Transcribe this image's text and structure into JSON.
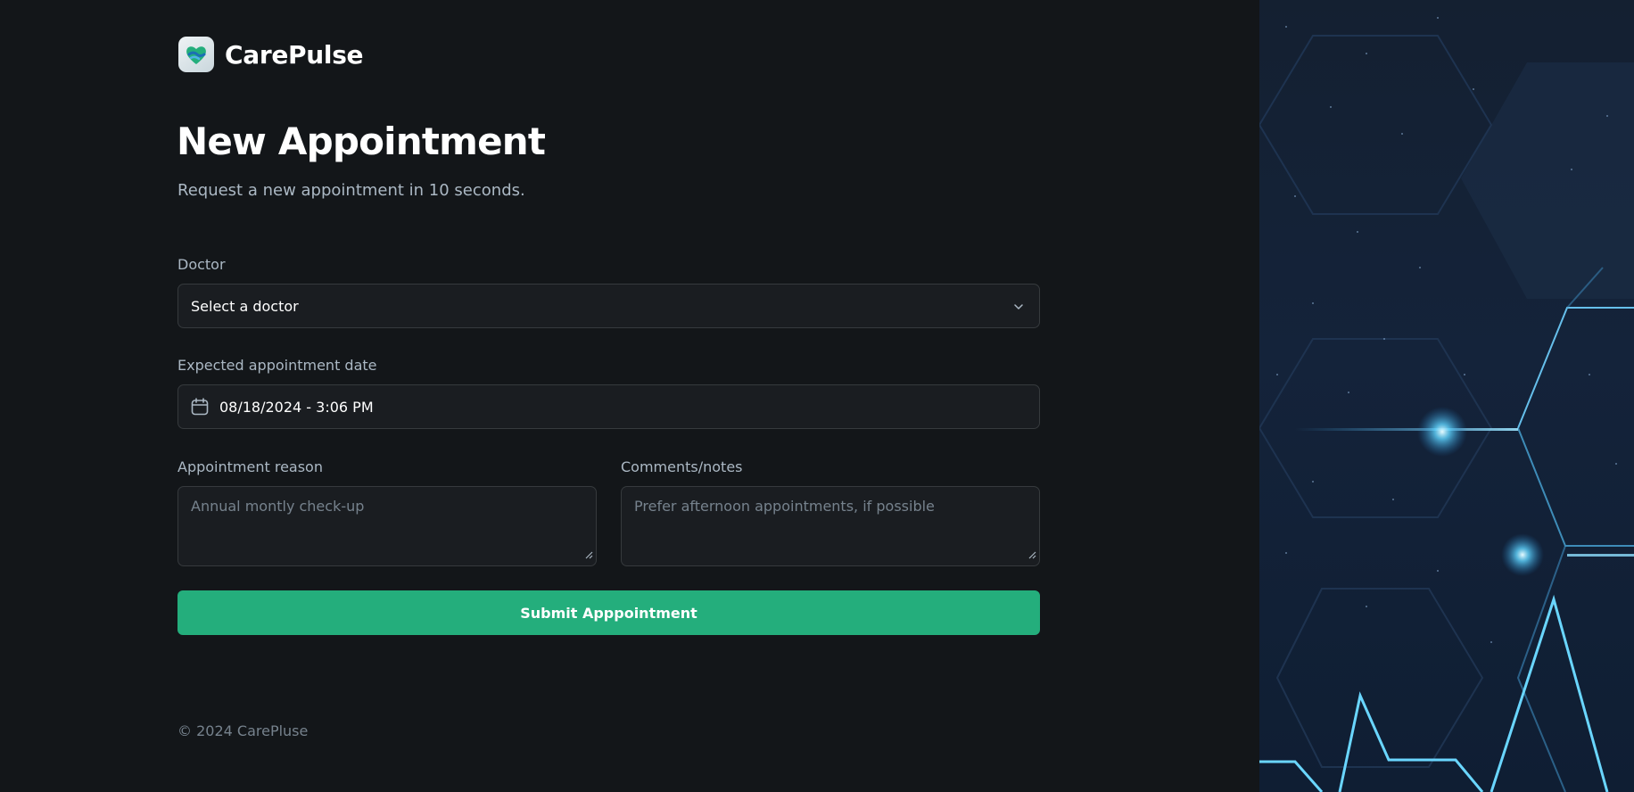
{
  "brand": {
    "name": "CarePulse",
    "logo_icon": "heart-hands-logo-icon",
    "accent": "#24ae7c"
  },
  "header": {
    "title": "New Appointment",
    "subtitle": "Request a new appointment in 10 seconds."
  },
  "form": {
    "doctor": {
      "label": "Doctor",
      "placeholder": "Select a doctor",
      "icon": "chevron-down-icon"
    },
    "date": {
      "label": "Expected appointment date",
      "value": "08/18/2024 - 3:06 PM",
      "icon": "calendar-icon"
    },
    "reason": {
      "label": "Appointment reason",
      "placeholder": "Annual montly check-up"
    },
    "notes": {
      "label": "Comments/notes",
      "placeholder": "Prefer afternoon appointments, if possible"
    },
    "submit_label": "Submit Apppointment"
  },
  "footer": {
    "copyright": "© 2024 CarePluse"
  },
  "colors": {
    "background": "#131619",
    "field_bg": "#1a1d21",
    "field_border": "#363a3d",
    "muted_text": "#abb8c4",
    "placeholder_text": "#76828d"
  }
}
